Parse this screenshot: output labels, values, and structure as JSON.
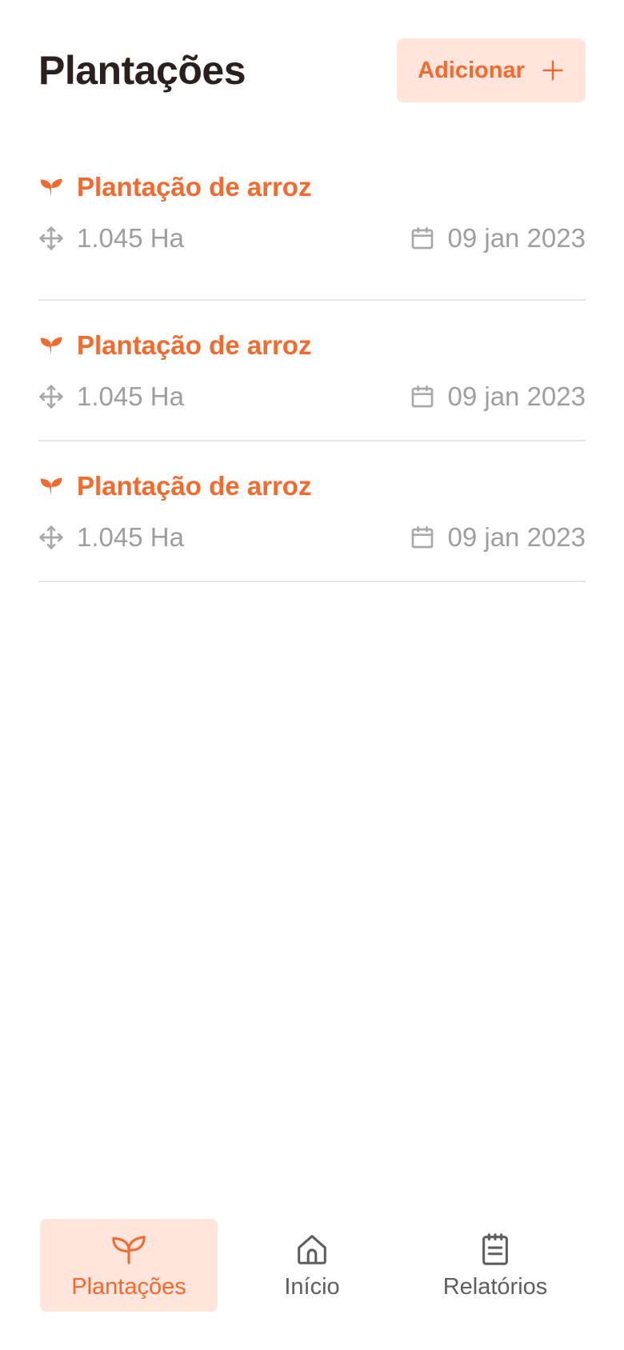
{
  "header": {
    "title": "Plantações",
    "add_label": "Adicionar"
  },
  "plantations": [
    {
      "name": "Plantação de arroz",
      "area": "1.045 Ha",
      "date": "09 jan 2023"
    },
    {
      "name": "Plantação de arroz",
      "area": "1.045 Ha",
      "date": "09 jan 2023"
    },
    {
      "name": "Plantação de arroz",
      "area": "1.045 Ha",
      "date": "09 jan 2023"
    }
  ],
  "nav": {
    "items": [
      {
        "label": "Plantações",
        "icon": "sprout-icon",
        "active": true
      },
      {
        "label": "Início",
        "icon": "home-icon",
        "active": false
      },
      {
        "label": "Relatórios",
        "icon": "clipboard-icon",
        "active": false
      }
    ]
  },
  "colors": {
    "accent": "#f26a2e",
    "accent_bg": "#ffe5dc",
    "title": "#2a211e",
    "muted": "#9e9e9e",
    "divider": "#e6e6e6"
  }
}
